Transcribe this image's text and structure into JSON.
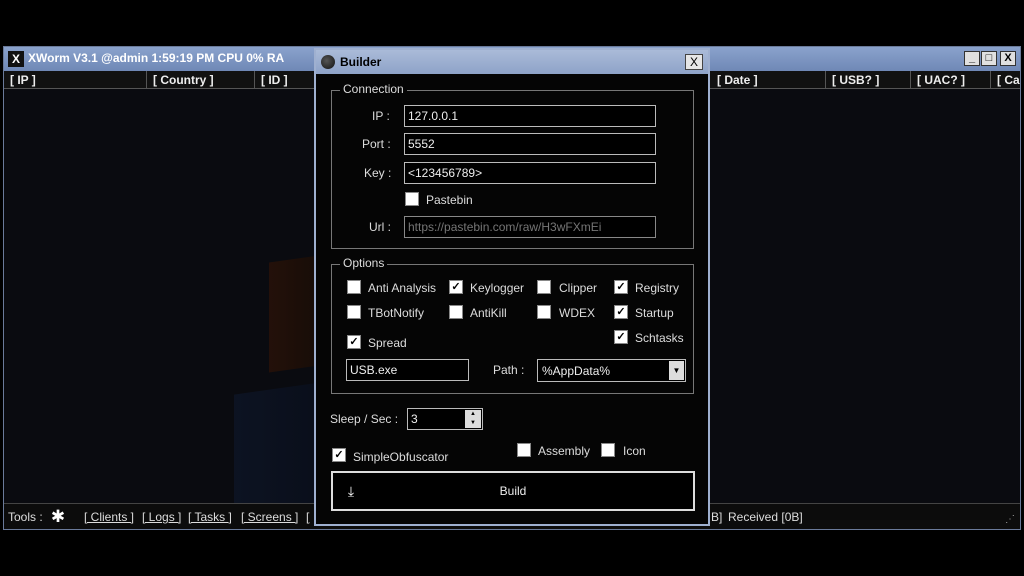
{
  "main_window": {
    "title": "XWorm V3.1 @admin   1:59:19 PM   CPU 0%   RA",
    "title_icon": "X",
    "controls": {
      "minimize": "_",
      "maximize": "□",
      "close": "X"
    },
    "columns": [
      "[ IP ]",
      "[ Country ]",
      "[ ID ]",
      "[ Date ]",
      "[ USB? ]",
      "[ UAC? ]",
      "[ Ca"
    ],
    "status": {
      "tools_label": "Tools :",
      "links": [
        "[ Clients ]",
        "[ Logs ]",
        "[ Tasks ]",
        "[ Screens ]",
        "["
      ],
      "received_prefix": "B]",
      "received": "Received [0B]"
    }
  },
  "builder": {
    "title": "Builder",
    "close_label": "X",
    "connection": {
      "legend": "Connection",
      "ip_label": "IP :",
      "ip_value": "127.0.0.1",
      "port_label": "Port :",
      "port_value": "5552",
      "key_label": "Key :",
      "key_value": "<123456789>",
      "pastebin_label": "Pastebin",
      "pastebin_checked": false,
      "url_label": "Url :",
      "url_placeholder": "https://pastebin.com/raw/H3wFXmEi"
    },
    "options": {
      "legend": "Options",
      "anti_analysis": {
        "label": "Anti Analysis",
        "checked": false
      },
      "keylogger": {
        "label": "Keylogger",
        "checked": true
      },
      "clipper": {
        "label": "Clipper",
        "checked": false
      },
      "registry": {
        "label": "Registry",
        "checked": true
      },
      "tbotnotify": {
        "label": "TBotNotify",
        "checked": false
      },
      "antikill": {
        "label": "AntiKill",
        "checked": false
      },
      "wdex": {
        "label": "WDEX",
        "checked": false
      },
      "startup": {
        "label": "Startup",
        "checked": true
      },
      "schtasks": {
        "label": "Schtasks",
        "checked": true
      },
      "spread": {
        "label": "Spread",
        "checked": true
      },
      "usb_name": "USB.exe",
      "path_label": "Path :",
      "path_value": "%AppData%"
    },
    "sleep_label": "Sleep / Sec :",
    "sleep_value": "3",
    "simple_obfuscator": {
      "label": "SimpleObfuscator",
      "checked": true
    },
    "assembly": {
      "label": "Assembly",
      "checked": false
    },
    "icon": {
      "label": "Icon",
      "checked": false
    },
    "build_label": "Build",
    "check_mark": "✓"
  }
}
